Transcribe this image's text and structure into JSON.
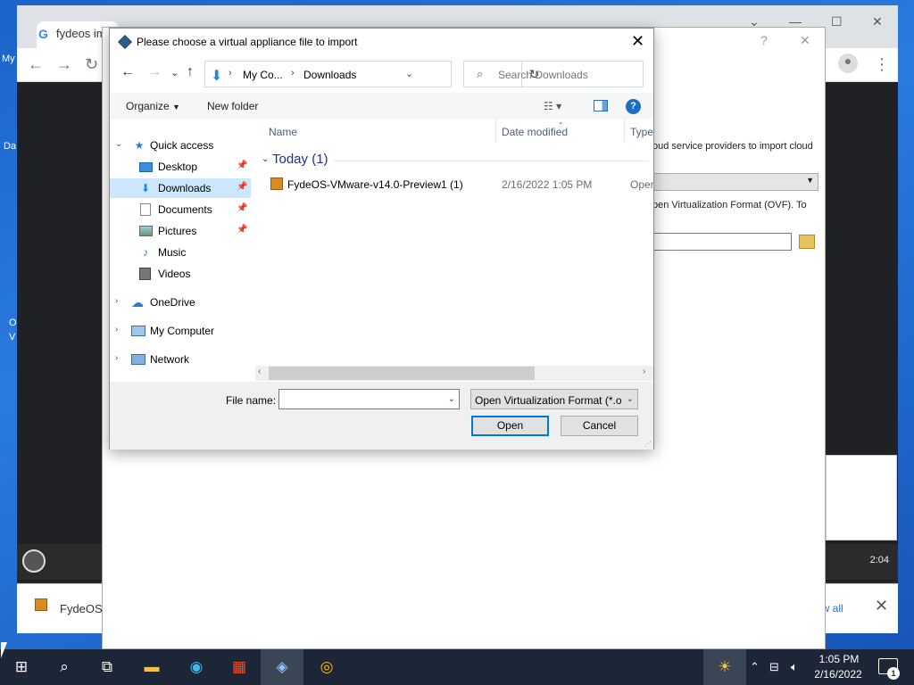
{
  "browser": {
    "tab_title": "fydeos im",
    "download_item": "FydeOS-",
    "show_all": "ow all"
  },
  "desktop": {
    "label_1": "My",
    "label_2": "Da",
    "label_3": "O",
    "label_4": "V"
  },
  "vbox_manager": {
    "hint_line1": "oud service providers to import cloud",
    "hint_line2": "pen Virtualization Format (OVF). To"
  },
  "fydeos": {
    "clock": "2:04"
  },
  "dialog": {
    "title": "Please choose a virtual appliance file to import",
    "address": {
      "crumb1": "My Co...",
      "crumb2": "Downloads"
    },
    "search_placeholder": "Search Downloads",
    "commands": {
      "organize": "Organize",
      "new_folder": "New folder"
    },
    "nav_tree": {
      "quick_access": "Quick access",
      "desktop": "Desktop",
      "downloads": "Downloads",
      "documents": "Documents",
      "pictures": "Pictures",
      "music": "Music",
      "videos": "Videos",
      "onedrive": "OneDrive",
      "my_computer": "My Computer",
      "network": "Network"
    },
    "columns": {
      "name": "Name",
      "date_modified": "Date modified",
      "type": "Type"
    },
    "group": "Today (1)",
    "files": [
      {
        "name": "FydeOS-VMware-v14.0-Preview1 (1)",
        "date": "2/16/2022 1:05 PM",
        "type": "Oper"
      }
    ],
    "file_name_label": "File name:",
    "file_name_value": "",
    "filter": "Open Virtualization Format (*.o",
    "open_button": "Open",
    "cancel_button": "Cancel"
  },
  "taskbar": {
    "time": "1:05 PM",
    "date": "2/16/2022",
    "notifications": "1"
  }
}
